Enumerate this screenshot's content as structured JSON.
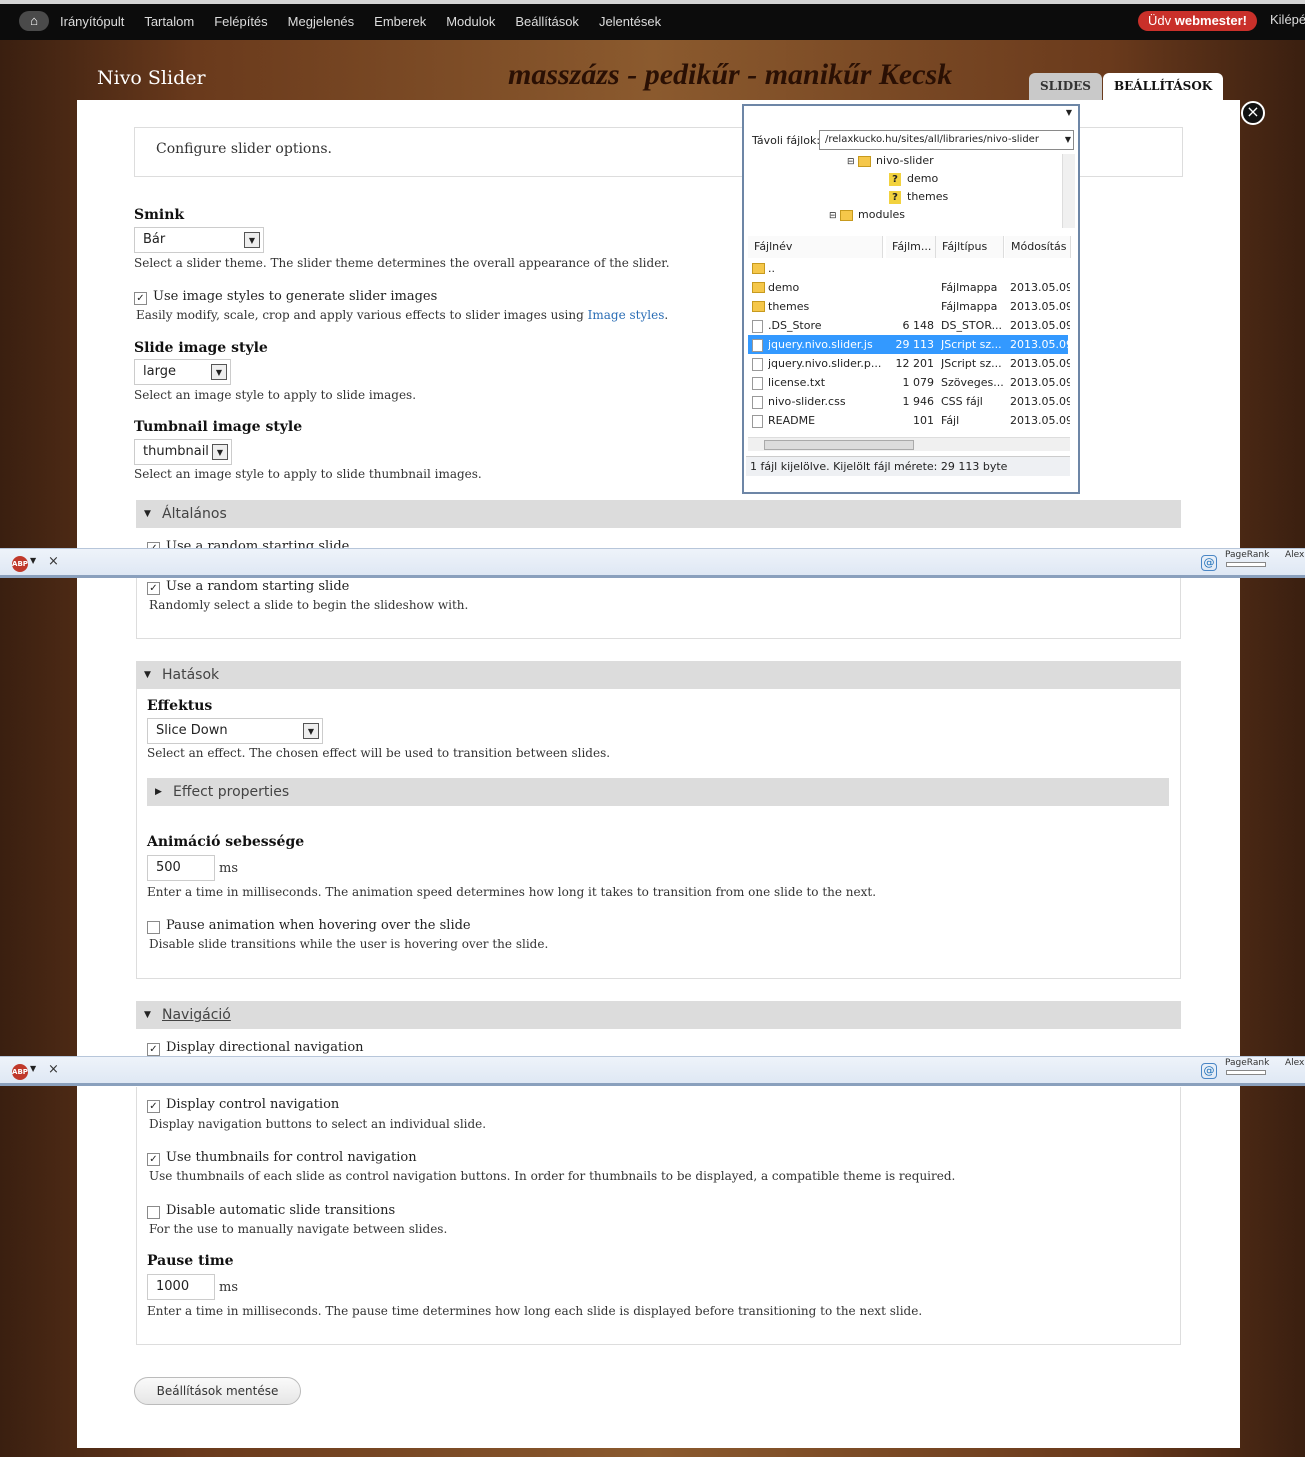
{
  "toolbar": {
    "menu": [
      "Irányítópult",
      "Tartalom",
      "Felépítés",
      "Megjelenés",
      "Emberek",
      "Modulok",
      "Beállítások",
      "Jelentések"
    ],
    "hello_prefix": "Üdv ",
    "hello_user": "webmester!",
    "logout": "Kilépé"
  },
  "header": {
    "site_title": "Nivo Slider",
    "slogan": "masszázs - pedikűr - manikűr Kecsk",
    "tabs": [
      "SLIDES",
      "BEÁLLÍTÁSOK"
    ]
  },
  "form": {
    "intro": "Configure slider options.",
    "theme": {
      "label": "Smink",
      "value": "Bár",
      "desc": "Select a slider theme. The slider theme determines the overall appearance of the slider."
    },
    "use_image_styles": {
      "label": "Use image styles to generate slider images",
      "desc_prefix": "Easily modify, scale, crop and apply various effects to slider images using ",
      "desc_link": "Image styles",
      "desc_suffix": "."
    },
    "slide_style": {
      "label": "Slide image style",
      "value": "large",
      "desc": "Select an image style to apply to slide images."
    },
    "thumb_style": {
      "label": "Tumbnail image style",
      "value": "thumbnail",
      "desc": "Select an image style to apply to slide thumbnail images."
    },
    "general": {
      "legend": "Általános",
      "random_label": "Use a random starting slide",
      "random_desc": "Randomly select a slide to begin the slideshow with."
    },
    "effects": {
      "legend": "Hatások",
      "effect_label": "Effektus",
      "effect_value": "Slice Down",
      "effect_desc": "Select an effect. The chosen effect will be used to transition between slides.",
      "props_legend": "Effect properties",
      "speed_label": "Animáció sebessége",
      "speed_value": "500",
      "speed_unit": "ms",
      "speed_desc": "Enter a time in milliseconds. The animation speed determines how long it takes to transition from one slide to the next.",
      "pause_label": "Pause animation when hovering over the slide",
      "pause_desc": "Disable slide transitions while the user is hovering over the slide."
    },
    "navigation": {
      "legend": "Navigáció",
      "directional_label": "Display directional navigation",
      "control_label": "Display control navigation",
      "control_desc": "Display navigation buttons to select an individual slide.",
      "thumbs_label": "Use thumbnails for control navigation",
      "thumbs_desc": "Use thumbnails of each slide as control navigation buttons. In order for thumbnails to be displayed, a compatible theme is required.",
      "manual_label": "Disable automatic slide transitions",
      "manual_desc": "For the use to manually navigate between slides.",
      "pause_time_label": "Pause time",
      "pause_time_value": "1000",
      "pause_time_unit": "ms",
      "pause_time_desc": "Enter a time in milliseconds. The pause time determines how long each slide is displayed before transitioning to the next slide."
    },
    "save": "Beállítások mentése"
  },
  "statusbar": {
    "abp": "ABP",
    "pagerank": "PageRank",
    "alexa": "Alex"
  },
  "file_manager": {
    "address_label": "Távoli fájlok:",
    "address": "/relaxkucko.hu/sites/all/libraries/nivo-slider",
    "tree": [
      "nivo-slider",
      "demo",
      "themes",
      "modules"
    ],
    "columns": [
      "Fájlnév",
      "Fájlm...",
      "Fájltípus",
      "Módosítás"
    ],
    "files": [
      {
        "name": "..",
        "size": "",
        "type": "",
        "date": ""
      },
      {
        "name": "demo",
        "size": "",
        "type": "Fájlmappa",
        "date": "2013.05.09."
      },
      {
        "name": "themes",
        "size": "",
        "type": "Fájlmappa",
        "date": "2013.05.09."
      },
      {
        "name": ".DS_Store",
        "size": "6 148",
        "type": "DS_STOR...",
        "date": "2013.05.09."
      },
      {
        "name": "jquery.nivo.slider.js",
        "size": "29 113",
        "type": "JScript sz...",
        "date": "2013.05.09."
      },
      {
        "name": "jquery.nivo.slider.p...",
        "size": "12 201",
        "type": "JScript sz...",
        "date": "2013.05.09."
      },
      {
        "name": "license.txt",
        "size": "1 079",
        "type": "Szöveges...",
        "date": "2013.05.09."
      },
      {
        "name": "nivo-slider.css",
        "size": "1 946",
        "type": "CSS fájl",
        "date": "2013.05.09."
      },
      {
        "name": "README",
        "size": "101",
        "type": "Fájl",
        "date": "2013.05.09."
      }
    ],
    "status": "1 fájl kijelölve. Kijelölt fájl mérete: 29 113 byte"
  },
  "colors": {
    "selected_row": "#3399ff",
    "hello_badge": "#c9302a",
    "link": "#2a6db5"
  }
}
